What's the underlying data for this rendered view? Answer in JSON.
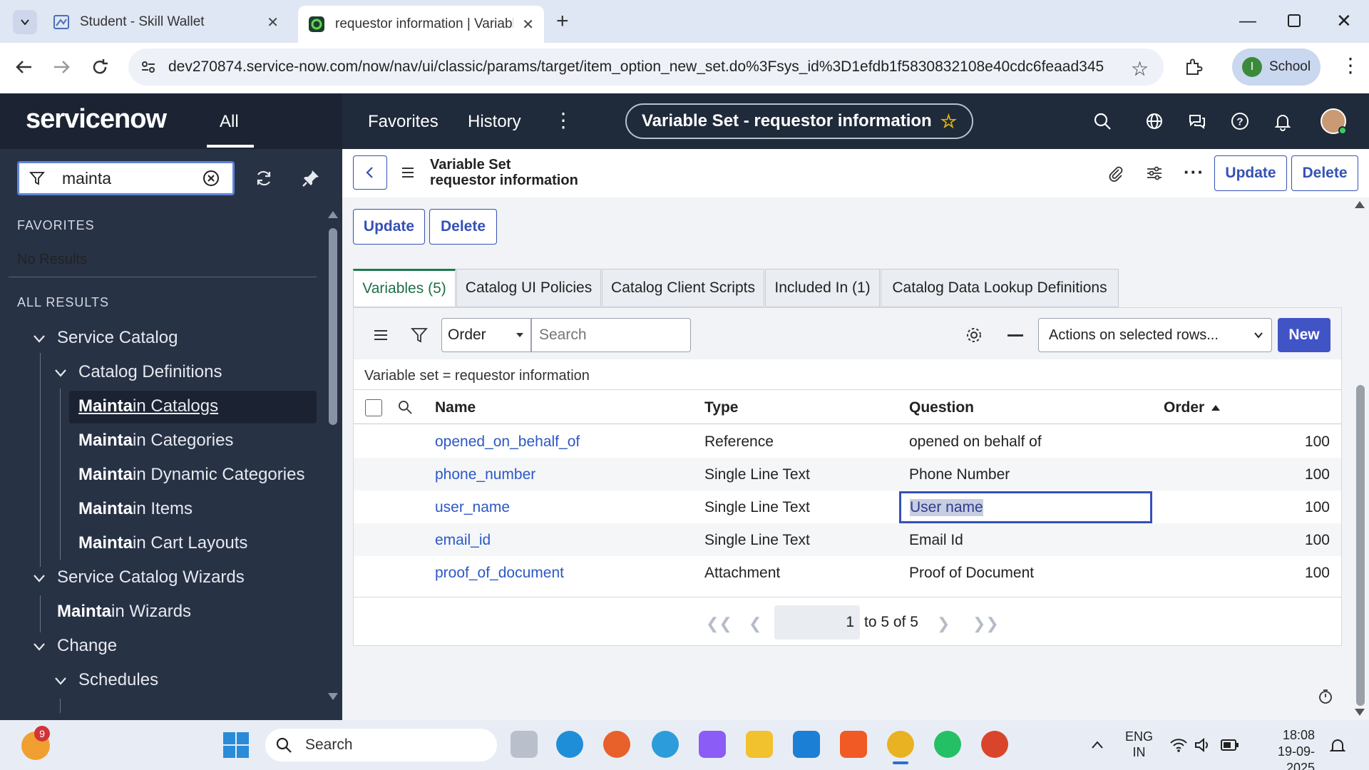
{
  "browser": {
    "tabs": [
      {
        "title": "Student - Skill Wallet"
      },
      {
        "title": "requestor information | Variable"
      }
    ],
    "url": "dev270874.service-now.com/now/nav/ui/classic/params/target/item_option_new_set.do%3Fsys_id%3D1efdb1f5830832108e40cdc6feaad345",
    "profile_label": "School",
    "profile_initial": "I"
  },
  "sn_header": {
    "logo": "servicenow",
    "all_label": "All",
    "favorites_label": "Favorites",
    "history_label": "History",
    "page_title": "Variable Set - requestor information"
  },
  "sidebar": {
    "filter_value": "mainta",
    "favorites_heading": "FAVORITES",
    "no_results": "No Results",
    "all_results_heading": "ALL RESULTS",
    "items": [
      {
        "match": "",
        "rest": "Service Catalog"
      },
      {
        "match": "",
        "rest": "Catalog Definitions"
      },
      {
        "match": "Mainta",
        "rest": "in Catalogs"
      },
      {
        "match": "Mainta",
        "rest": "in Categories"
      },
      {
        "match": "Mainta",
        "rest": "in Dynamic Categories"
      },
      {
        "match": "Mainta",
        "rest": "in Items"
      },
      {
        "match": "Mainta",
        "rest": "in Cart Layouts"
      },
      {
        "match": "",
        "rest": "Service Catalog Wizards"
      },
      {
        "match": "Mainta",
        "rest": "in Wizards"
      },
      {
        "match": "",
        "rest": "Change"
      },
      {
        "match": "",
        "rest": "Schedules"
      }
    ]
  },
  "form": {
    "record_type": "Variable Set",
    "record_name": "requestor information",
    "update_label": "Update",
    "delete_label": "Delete",
    "tabs": [
      {
        "label": "Variables (5)"
      },
      {
        "label": "Catalog UI Policies"
      },
      {
        "label": "Catalog Client Scripts"
      },
      {
        "label": "Included In (1)"
      },
      {
        "label": "Catalog Data Lookup Definitions"
      }
    ]
  },
  "list": {
    "search_field": "Order",
    "search_placeholder": "Search",
    "actions_label": "Actions on selected rows...",
    "new_label": "New",
    "breadcrumb": "Variable set = requestor information",
    "columns": {
      "name": "Name",
      "type": "Type",
      "question": "Question",
      "order": "Order"
    },
    "rows": [
      {
        "name": "opened_on_behalf_of",
        "type": "Reference",
        "question": "opened on behalf of",
        "order": "100"
      },
      {
        "name": "phone_number",
        "type": "Single Line Text",
        "question": "Phone Number",
        "order": "100"
      },
      {
        "name": "user_name",
        "type": "Single Line Text",
        "question": "User name",
        "order": "100"
      },
      {
        "name": "email_id",
        "type": "Single Line Text",
        "question": "Email Id",
        "order": "100"
      },
      {
        "name": "proof_of_document",
        "type": "Attachment",
        "question": "Proof of Document",
        "order": "100"
      }
    ],
    "pagination": {
      "page": "1",
      "range": "to 5 of 5"
    }
  },
  "taskbar": {
    "search_label": "Search",
    "notification_count": "9",
    "lang_line1": "ENG",
    "lang_line2": "IN",
    "time": "18:08",
    "date": "19-09-2025"
  },
  "colors": {
    "sn_header": "#1f2a3a",
    "sidebar": "#283245",
    "accent": "#3551b5",
    "link": "#2c58c6",
    "tab_active": "#1e7a4d"
  }
}
